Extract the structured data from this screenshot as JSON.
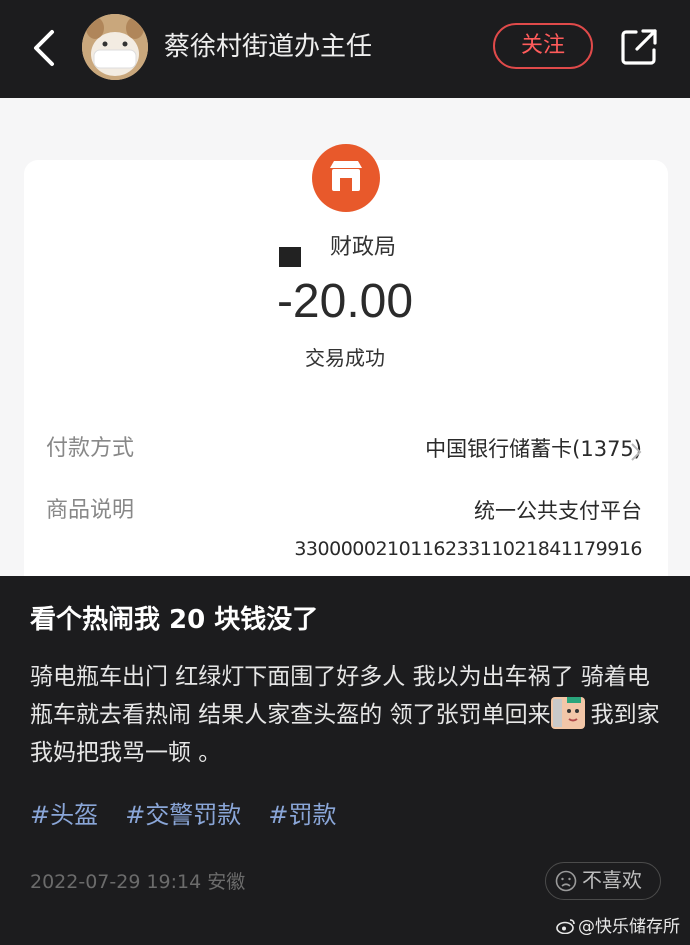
{
  "header": {
    "author_name": "蔡徐村街道办主任",
    "follow_label": "关注"
  },
  "receipt": {
    "merchant": "财政局",
    "amount": "-20.00",
    "status": "交易成功",
    "payment_method_label": "付款方式",
    "payment_method_value": "中国银行储蓄卡(1375)",
    "description_label": "商品说明",
    "description_value": "统一公共支付平台",
    "order_number": "330000021011623311021841179916"
  },
  "post": {
    "title": "看个热闹我 20 块钱没了",
    "body_part1": "骑电瓶车出门 红绿灯下面围了好多人 我以为出车祸了 骑着电瓶车就去看热闹 结果人家查头盔的 领了张罚单回来",
    "body_part2": "我到家我妈把我骂一顿 。",
    "tags": [
      "#头盔",
      "#交警罚款",
      "#罚款"
    ],
    "meta": "2022-07-29 19:14 安徽",
    "dislike_label": "不喜欢"
  },
  "watermark": {
    "text": "@快乐储存所"
  },
  "colors": {
    "background": "#1c1c1e",
    "follow_accent": "#ff5b5b",
    "tag_color": "#8aa6d8",
    "shop_icon": "#e8592b"
  }
}
